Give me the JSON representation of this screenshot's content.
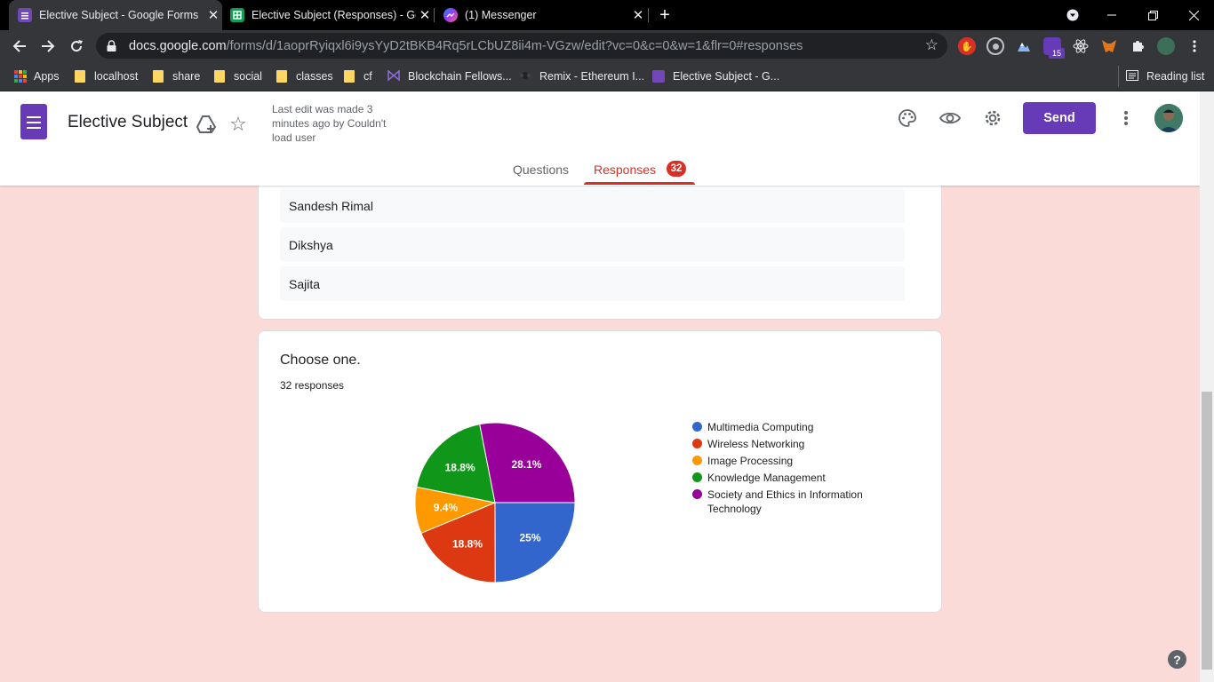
{
  "browser": {
    "tabs": [
      {
        "title": "Elective Subject - Google Forms",
        "active": true,
        "favicon": "google-forms-icon"
      },
      {
        "title": "Elective Subject (Responses) - Go",
        "active": false,
        "favicon": "google-sheets-icon"
      },
      {
        "title": "(1) Messenger",
        "active": false,
        "favicon": "messenger-icon"
      }
    ],
    "url_host": "docs.google.com",
    "url_path": "/forms/d/1aoprRyiqxl6i9ysYyD2tBKB4Rq5rLCbUZ8ii4m-VGzw/edit?vc=0&c=0&w=1&flr=0#responses",
    "extension_badge": "15",
    "bookmarks": [
      "Apps",
      "localhost",
      "share",
      "social",
      "classes",
      "cf",
      "Blockchain Fellows...",
      "Remix - Ethereum I...",
      "Elective Subject - G..."
    ],
    "reading_list": "Reading list"
  },
  "form": {
    "title": "Elective Subject",
    "last_edit": "Last edit was made 3 minutes ago by Couldn't load user",
    "send_label": "Send",
    "tabs": {
      "questions": "Questions",
      "responses": "Responses",
      "responses_count": "32"
    }
  },
  "responses_list": [
    "Sandesh Rimal",
    "Dikshya",
    "Sajita"
  ],
  "question": {
    "title": "Choose one.",
    "count": "32 responses"
  },
  "chart_data": {
    "type": "pie",
    "slices": [
      {
        "label": "Multimedia Computing",
        "value": 25,
        "display": "25%",
        "color": "#3366cc"
      },
      {
        "label": "Wireless Networking",
        "value": 18.8,
        "display": "18.8%",
        "color": "#dc3912"
      },
      {
        "label": "Image Processing",
        "value": 9.4,
        "display": "9.4%",
        "color": "#ff9900"
      },
      {
        "label": "Knowledge Management",
        "value": 18.8,
        "display": "18.8%",
        "color": "#109618"
      },
      {
        "label": "Society and Ethics in Information Technology",
        "value": 28.1,
        "display": "28.1%",
        "color": "#990099"
      }
    ],
    "legend_position": "right",
    "units": "percent"
  }
}
